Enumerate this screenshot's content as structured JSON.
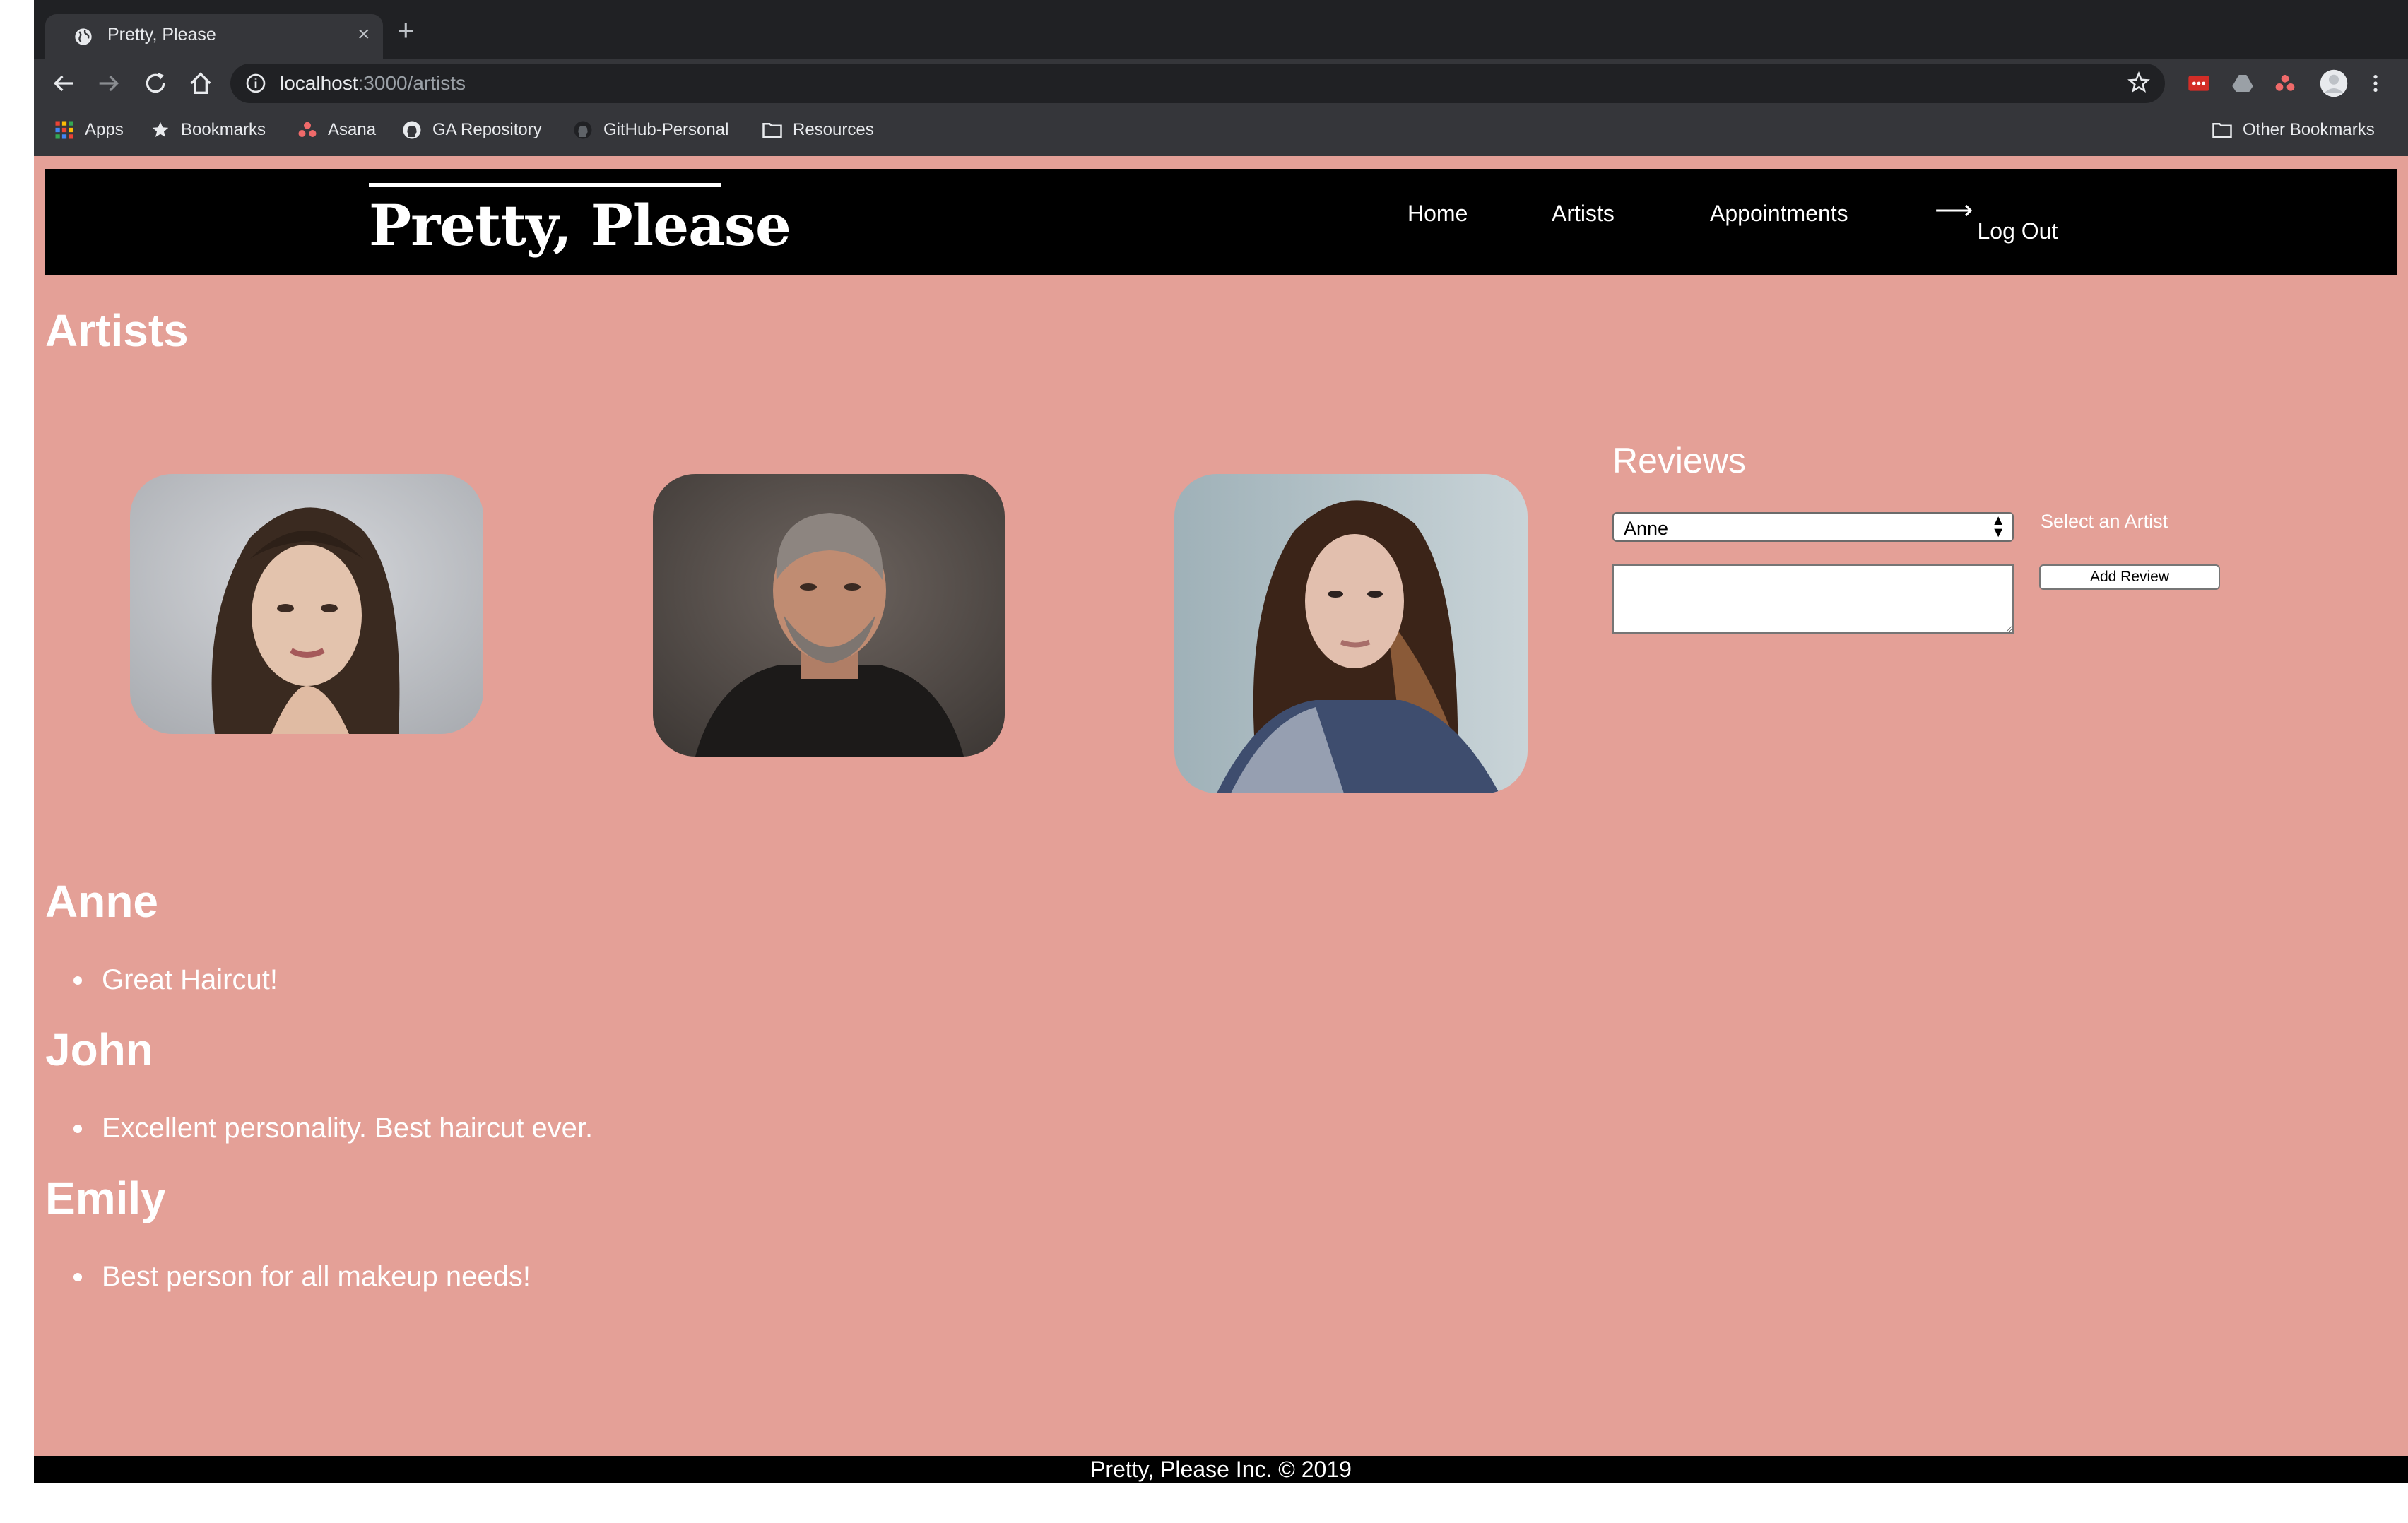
{
  "browser": {
    "tab_title": "Pretty, Please",
    "tab_close": "×",
    "new_tab": "+",
    "url_host": "localhost",
    "url_path": ":3000/artists",
    "bookmarks": [
      "Apps",
      "Bookmarks",
      "Asana",
      "GA Repository",
      "GitHub-Personal",
      "Resources"
    ],
    "other_bookmarks": "Other Bookmarks"
  },
  "site": {
    "brand": "Pretty, Please",
    "nav": [
      "Home",
      "Artists",
      "Appointments"
    ],
    "logout_arrow": "⟶",
    "logout": "Log Out"
  },
  "main": {
    "heading": "Artists",
    "reviews_title": "Reviews",
    "select_value": "Anne",
    "select_hint": "Select an Artist",
    "add_review": "Add Review",
    "artists": [
      {
        "name": "Anne",
        "reviews": [
          "Great Haircut!"
        ]
      },
      {
        "name": "John",
        "reviews": [
          "Excellent personality. Best haircut ever."
        ]
      },
      {
        "name": "Emily",
        "reviews": [
          "Best person for all makeup needs!"
        ]
      }
    ]
  },
  "footer": "Pretty, Please Inc. © 2019"
}
